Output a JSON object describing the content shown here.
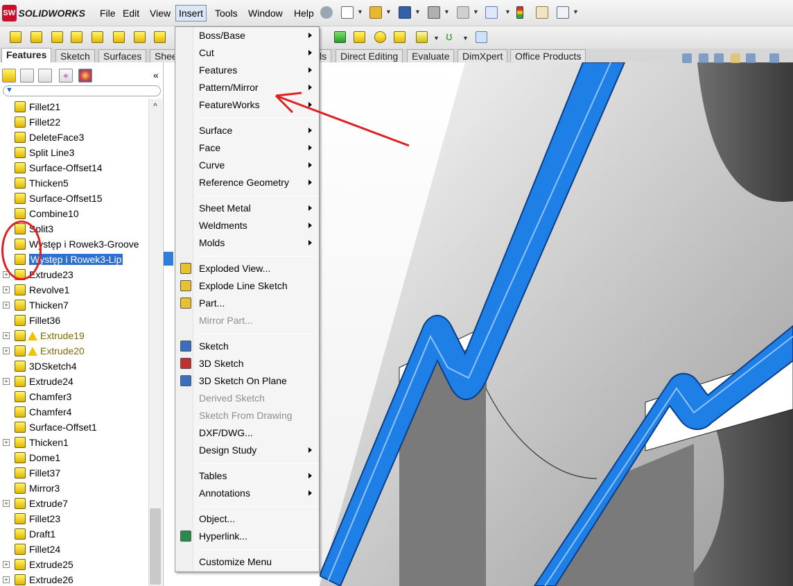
{
  "app": {
    "logo_mark": "SW",
    "logo_text": "SOLIDWORKS"
  },
  "menubar": {
    "items": [
      {
        "label": "File"
      },
      {
        "label": "Edit"
      },
      {
        "label": "View"
      },
      {
        "label": "Insert"
      },
      {
        "label": "Tools"
      },
      {
        "label": "Window"
      },
      {
        "label": "Help"
      }
    ]
  },
  "command_tabs": [
    "Features",
    "Sketch",
    "Surfaces",
    "Shee",
    "ls",
    "Direct Editing",
    "Evaluate",
    "DimXpert",
    "Office Products"
  ],
  "feature_tree": {
    "items": [
      {
        "label": "Fillet21",
        "expandable": false,
        "warning": false,
        "selected": false
      },
      {
        "label": "Fillet22",
        "expandable": false,
        "warning": false,
        "selected": false
      },
      {
        "label": "DeleteFace3",
        "expandable": false,
        "warning": false,
        "selected": false
      },
      {
        "label": "Split Line3",
        "expandable": false,
        "warning": false,
        "selected": false
      },
      {
        "label": "Surface-Offset14",
        "expandable": false,
        "warning": false,
        "selected": false
      },
      {
        "label": "Thicken5",
        "expandable": false,
        "warning": false,
        "selected": false
      },
      {
        "label": "Surface-Offset15",
        "expandable": false,
        "warning": false,
        "selected": false
      },
      {
        "label": "Combine10",
        "expandable": false,
        "warning": false,
        "selected": false
      },
      {
        "label": "Split3",
        "expandable": false,
        "warning": false,
        "selected": false
      },
      {
        "label": "Występ i Rowek3-Groove",
        "expandable": false,
        "warning": false,
        "selected": false
      },
      {
        "label": "Występ i Rowek3-Lip",
        "expandable": false,
        "warning": false,
        "selected": true
      },
      {
        "label": "Extrude23",
        "expandable": true,
        "warning": false,
        "selected": false
      },
      {
        "label": "Revolve1",
        "expandable": true,
        "warning": false,
        "selected": false
      },
      {
        "label": "Thicken7",
        "expandable": true,
        "warning": false,
        "selected": false
      },
      {
        "label": "Fillet36",
        "expandable": false,
        "warning": false,
        "selected": false
      },
      {
        "label": "Extrude19",
        "expandable": true,
        "warning": true,
        "selected": false
      },
      {
        "label": "Extrude20",
        "expandable": true,
        "warning": true,
        "selected": false
      },
      {
        "label": "3DSketch4",
        "expandable": false,
        "warning": false,
        "selected": false
      },
      {
        "label": "Extrude24",
        "expandable": true,
        "warning": false,
        "selected": false
      },
      {
        "label": "Chamfer3",
        "expandable": false,
        "warning": false,
        "selected": false
      },
      {
        "label": "Chamfer4",
        "expandable": false,
        "warning": false,
        "selected": false
      },
      {
        "label": "Surface-Offset1",
        "expandable": false,
        "warning": false,
        "selected": false
      },
      {
        "label": "Thicken1",
        "expandable": true,
        "warning": false,
        "selected": false
      },
      {
        "label": "Dome1",
        "expandable": false,
        "warning": false,
        "selected": false
      },
      {
        "label": "Fillet37",
        "expandable": false,
        "warning": false,
        "selected": false
      },
      {
        "label": "Mirror3",
        "expandable": false,
        "warning": false,
        "selected": false
      },
      {
        "label": "Extrude7",
        "expandable": true,
        "warning": false,
        "selected": false
      },
      {
        "label": "Fillet23",
        "expandable": false,
        "warning": false,
        "selected": false
      },
      {
        "label": "Draft1",
        "expandable": false,
        "warning": false,
        "selected": false
      },
      {
        "label": "Fillet24",
        "expandable": false,
        "warning": false,
        "selected": false
      },
      {
        "label": "Extrude25",
        "expandable": true,
        "warning": false,
        "selected": false
      },
      {
        "label": "Extrude26",
        "expandable": true,
        "warning": false,
        "selected": false
      }
    ]
  },
  "insert_menu": {
    "items": [
      {
        "label": "Boss/Base",
        "submenu": true,
        "disabled": false
      },
      {
        "label": "Cut",
        "submenu": true,
        "disabled": false
      },
      {
        "label": "Features",
        "submenu": true,
        "disabled": false
      },
      {
        "label": "Pattern/Mirror",
        "submenu": true,
        "disabled": false
      },
      {
        "label": "FeatureWorks",
        "submenu": true,
        "disabled": false
      },
      {
        "label": "Surface",
        "submenu": true,
        "disabled": false
      },
      {
        "label": "Face",
        "submenu": true,
        "disabled": false
      },
      {
        "label": "Curve",
        "submenu": true,
        "disabled": false
      },
      {
        "label": "Reference Geometry",
        "submenu": true,
        "disabled": false
      },
      {
        "label": "Sheet Metal",
        "submenu": true,
        "disabled": false
      },
      {
        "label": "Weldments",
        "submenu": true,
        "disabled": false
      },
      {
        "label": "Molds",
        "submenu": true,
        "disabled": false
      },
      {
        "label": "Exploded View...",
        "submenu": false,
        "disabled": false
      },
      {
        "label": "Explode Line Sketch",
        "submenu": false,
        "disabled": false
      },
      {
        "label": "Part...",
        "submenu": false,
        "disabled": false
      },
      {
        "label": "Mirror Part...",
        "submenu": false,
        "disabled": true
      },
      {
        "label": "Sketch",
        "submenu": false,
        "disabled": false
      },
      {
        "label": "3D Sketch",
        "submenu": false,
        "disabled": false
      },
      {
        "label": "3D Sketch On Plane",
        "submenu": false,
        "disabled": false
      },
      {
        "label": "Derived Sketch",
        "submenu": false,
        "disabled": true
      },
      {
        "label": "Sketch From Drawing",
        "submenu": false,
        "disabled": true
      },
      {
        "label": "DXF/DWG...",
        "submenu": false,
        "disabled": false
      },
      {
        "label": "Design Study",
        "submenu": true,
        "disabled": false
      },
      {
        "label": "Tables",
        "submenu": true,
        "disabled": false
      },
      {
        "label": "Annotations",
        "submenu": true,
        "disabled": false
      },
      {
        "label": "Object...",
        "submenu": false,
        "disabled": false
      },
      {
        "label": "Hyperlink...",
        "submenu": false,
        "disabled": false
      },
      {
        "label": "Customize Menu",
        "submenu": false,
        "disabled": false
      }
    ]
  },
  "colors": {
    "selection_blue": "#2f6fd0",
    "model_edge_blue": "#1e7fe6",
    "annotation_red": "#e02020",
    "warning_yellow": "#f2c200"
  }
}
